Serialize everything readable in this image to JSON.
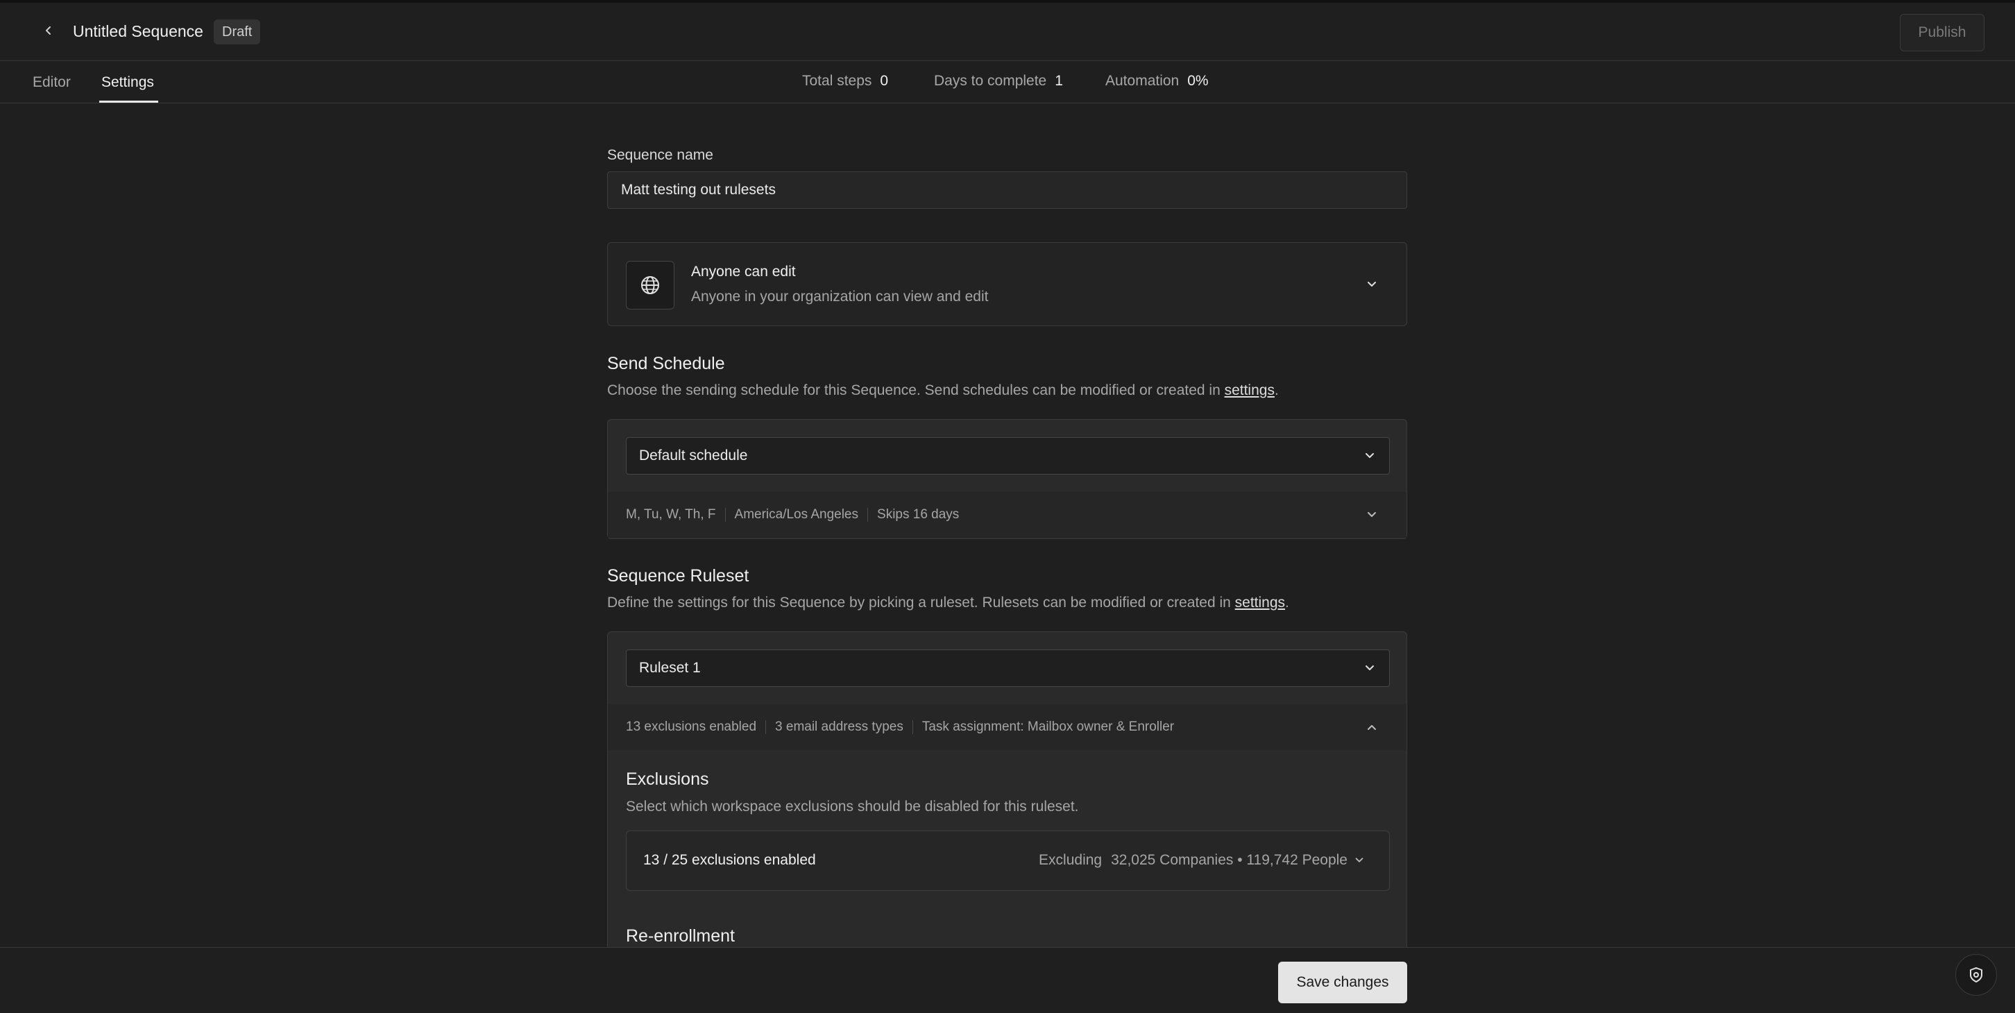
{
  "header": {
    "title": "Untitled Sequence",
    "badge": "Draft",
    "publish_label": "Publish"
  },
  "tabs": [
    {
      "label": "Editor",
      "active": false
    },
    {
      "label": "Settings",
      "active": true
    }
  ],
  "stats": {
    "total_steps_label": "Total steps",
    "total_steps_value": "0",
    "days_label": "Days to complete",
    "days_value": "1",
    "automation_label": "Automation",
    "automation_value": "0%"
  },
  "sequence_name": {
    "label": "Sequence name",
    "value": "Matt testing out rulesets"
  },
  "permission": {
    "icon": "globe-icon",
    "title": "Anyone can edit",
    "subtitle": "Anyone in your organization can view and edit"
  },
  "send_schedule": {
    "title": "Send Schedule",
    "desc_prefix": "Choose the sending schedule for this Sequence. Send schedules can be modified or created in ",
    "desc_link": "settings",
    "desc_suffix": ".",
    "selected": "Default schedule",
    "days": "M, Tu, W, Th, F",
    "timezone": "America/Los Angeles",
    "skips": "Skips 16 days"
  },
  "ruleset": {
    "title": "Sequence Ruleset",
    "desc_prefix": "Define the settings for this Sequence by picking a ruleset. Rulesets can be modified or created in ",
    "desc_link": "settings",
    "desc_suffix": ".",
    "selected": "Ruleset 1",
    "exclusions_enabled": "13 exclusions enabled",
    "email_types": "3 email address types",
    "task_assignment": "Task assignment: Mailbox owner & Enroller",
    "exclusions": {
      "title": "Exclusions",
      "desc": "Select which workspace exclusions should be disabled for this ruleset.",
      "count": "13 / 25 exclusions enabled",
      "excluding_label": "Excluding",
      "excluding_value": "32,025 Companies • 119,742 People"
    },
    "reenrollment_title": "Re-enrollment"
  },
  "footer": {
    "save_label": "Save changes",
    "help_icon": "shield-help-icon"
  }
}
